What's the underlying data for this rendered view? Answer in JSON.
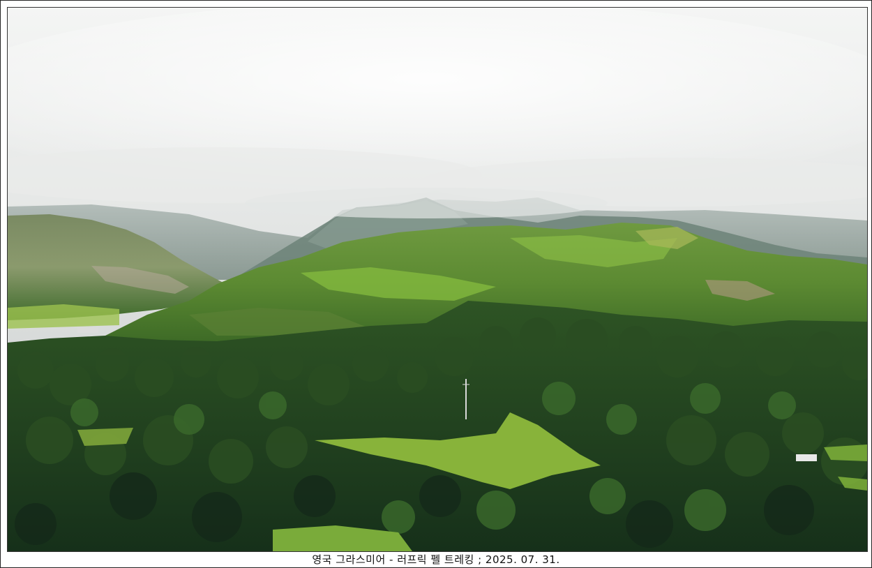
{
  "caption": "영국 그라스미어 - 러프릭 펠 트레킹 ; 2025. 07. 31.",
  "scene": {
    "sky_color": "#dcdedd",
    "cloud_color": "#f2f3f2",
    "far_mountain_color": "#7f938b",
    "mid_hill_color": "#5d8a3d",
    "grass_color": "#7fb13a",
    "forest_dark": "#1f3a1a",
    "forest_mid": "#2f5a24"
  }
}
